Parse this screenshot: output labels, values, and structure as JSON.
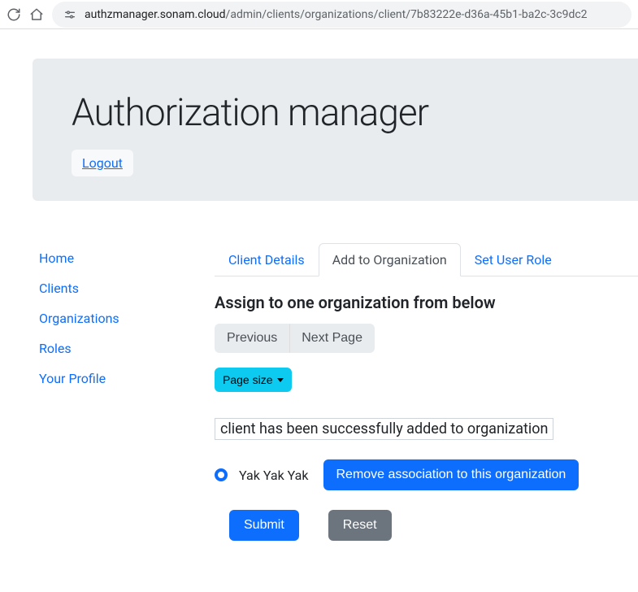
{
  "browser": {
    "url_host": "authzmanager.sonam.cloud",
    "url_path": "/admin/clients/organizations/client/7b83222e-d36a-45b1-ba2c-3c9dc2"
  },
  "header": {
    "title": "Authorization manager",
    "logout_label": "Logout"
  },
  "sidebar": {
    "items": [
      {
        "label": "Home"
      },
      {
        "label": "Clients"
      },
      {
        "label": "Organizations"
      },
      {
        "label": "Roles"
      },
      {
        "label": "Your Profile"
      }
    ]
  },
  "tabs": {
    "items": [
      {
        "label": "Client Details",
        "active": false
      },
      {
        "label": "Add to Organization",
        "active": true
      },
      {
        "label": "Set User Role",
        "active": false
      }
    ]
  },
  "assign": {
    "heading": "Assign to one organization from below",
    "prev_label": "Previous",
    "next_label": "Next Page",
    "page_size_label": "Page size",
    "status_message": "client has been successfully added to organization",
    "orgs": [
      {
        "name": "Yak Yak Yak",
        "selected": true
      }
    ],
    "remove_label": "Remove association to this organization",
    "submit_label": "Submit",
    "reset_label": "Reset"
  }
}
